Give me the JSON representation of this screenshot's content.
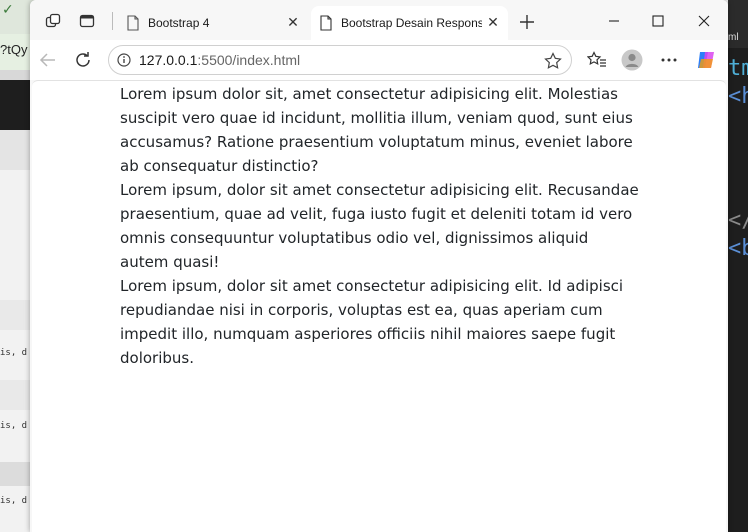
{
  "background": {
    "left_window": {
      "fragment_top": "?tQy",
      "code_lines": [
        "is, d",
        "is, d",
        "is, d"
      ]
    },
    "right_window": {
      "label": "ml",
      "code_fragments": [
        "tm",
        "<h",
        "</",
        "<b"
      ]
    }
  },
  "browser": {
    "tabs": [
      {
        "title": "Bootstrap 4",
        "active": false
      },
      {
        "title": "Bootstrap Desain Responsive",
        "active": true
      }
    ],
    "address": {
      "host": "127.0.0.1",
      "path": ":5500/index.html"
    },
    "icons": {
      "workspaces": "workspaces-icon",
      "tab_actions": "vertical-tabs-icon",
      "new_tab": "plus-icon",
      "back": "back-arrow-icon",
      "refresh": "refresh-icon",
      "info": "info-icon",
      "favorite": "star-icon",
      "favorites": "favorites-icon",
      "profile": "profile-icon",
      "more": "more-icon",
      "copilot": "copilot-icon"
    }
  },
  "page": {
    "paragraphs": [
      "Lorem ipsum dolor sit, amet consectetur adipisicing elit. Molestias suscipit vero quae id incidunt, mollitia illum, veniam quod, sunt eius accusamus? Ratione praesentium voluptatum minus, eveniet labore ab consequatur distinctio?",
      "Lorem ipsum, dolor sit amet consectetur adipisicing elit. Recusandae praesentium, quae ad velit, fuga iusto fugit et deleniti totam id vero omnis consequuntur voluptatibus odio vel, dignissimos aliquid autem quasi!",
      "Lorem ipsum, dolor sit amet consectetur adipisicing elit. Id adipisci repudiandae nisi in corporis, voluptas est ea, quas aperiam cum impedit illo, numquam asperiores officiis nihil maiores saepe fugit doloribus."
    ]
  }
}
